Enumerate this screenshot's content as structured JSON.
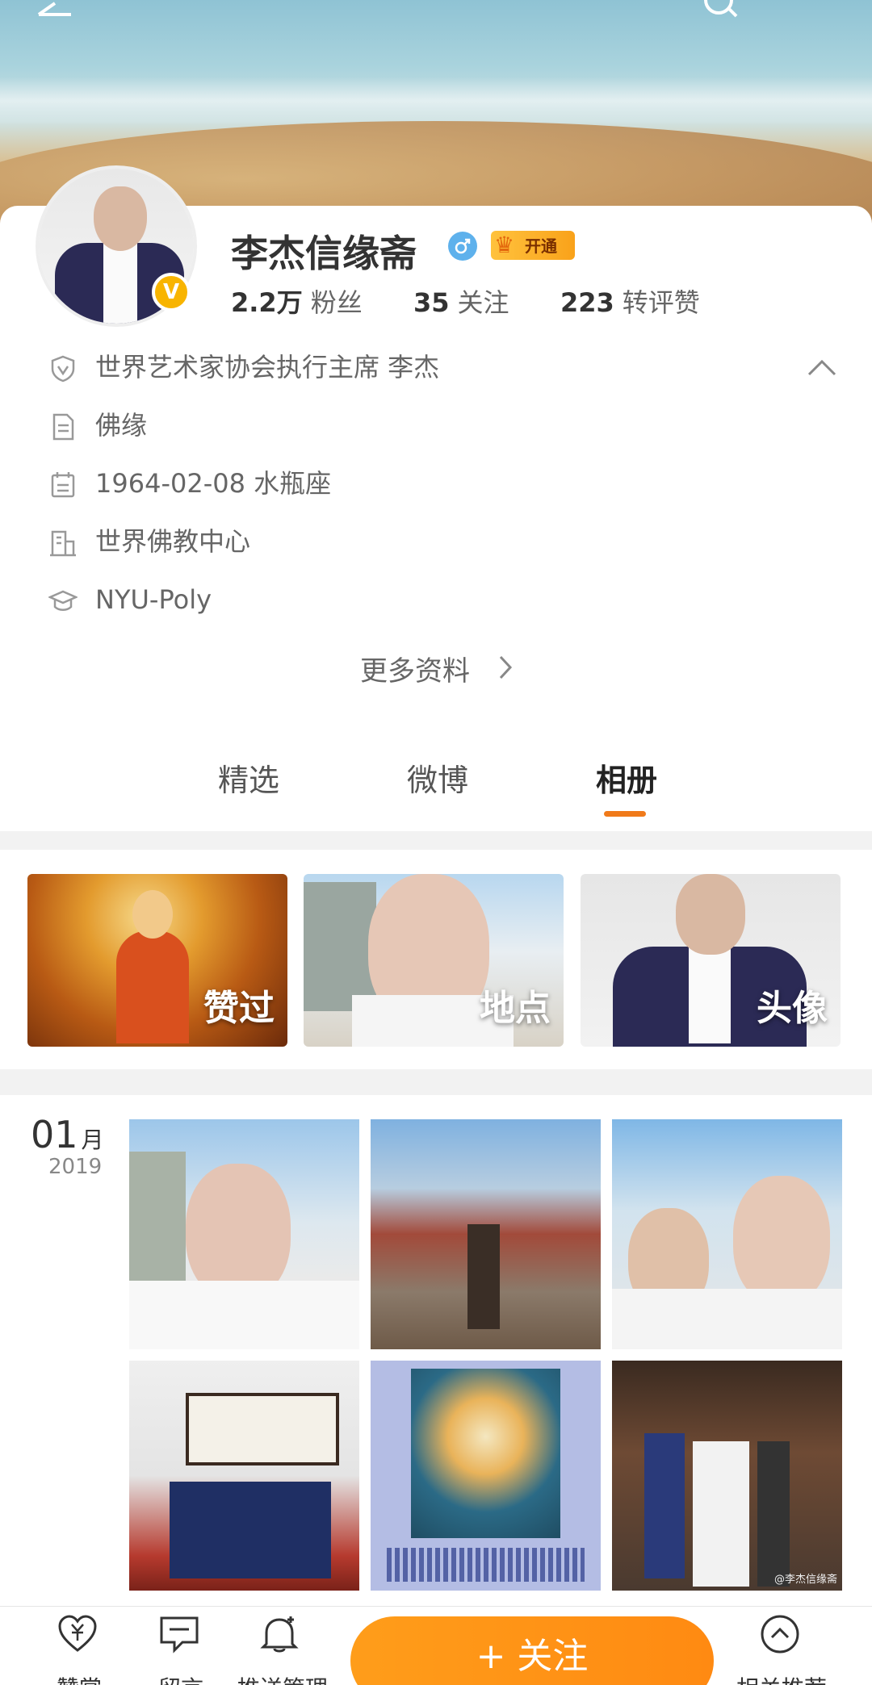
{
  "profile": {
    "name": "李杰信缘斋",
    "vip_label": "开通",
    "stats": [
      {
        "num": "2.2万",
        "label": "粉丝"
      },
      {
        "num": "35",
        "label": "关注"
      },
      {
        "num": "223",
        "label": "转评赞"
      }
    ],
    "info": [
      {
        "icon": "verified-shield-icon",
        "text": "世界艺术家协会执行主席 李杰"
      },
      {
        "icon": "document-icon",
        "text": "佛缘"
      },
      {
        "icon": "calendar-icon",
        "text": "1964-02-08 水瓶座"
      },
      {
        "icon": "building-icon",
        "text": "世界佛教中心"
      },
      {
        "icon": "graduation-cap-icon",
        "text": "NYU-Poly"
      }
    ],
    "more": "更多资料"
  },
  "tabs": [
    {
      "label": "精选"
    },
    {
      "label": "微博"
    },
    {
      "label": "相册",
      "active": true
    }
  ],
  "albums": [
    {
      "label": "赞过"
    },
    {
      "label": "地点"
    },
    {
      "label": "头像"
    }
  ],
  "photos": {
    "month": "01",
    "month_unit": "月",
    "year": "2019",
    "watermark": "@李杰信缘斋"
  },
  "bottom_bar": {
    "reward": "赞赏",
    "message": "留言",
    "push": "推送管理",
    "follow": "+ 关注",
    "related": "相关推荐"
  },
  "colors": {
    "accent": "#f07a1a",
    "follow_button": "#ff9d1a",
    "gender": "#5eb1ec",
    "vip": "#ffc23d"
  }
}
